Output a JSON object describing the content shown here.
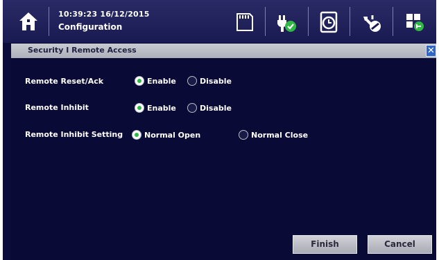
{
  "header": {
    "time": "10:39:23 16/12/2015",
    "context": "Configuration"
  },
  "icons": {
    "home": "home-icon",
    "sd_card": "sd-card-icon",
    "plug": "plug-check-icon",
    "clock": "clock-icon",
    "tools": "tools-icon",
    "grid": "grid-icon"
  },
  "dialog": {
    "title": "Security I Remote Access",
    "close_label": "✕",
    "rows": [
      {
        "label": "Remote Reset/Ack",
        "options": [
          {
            "label": "Enable",
            "selected": true
          },
          {
            "label": "Disable",
            "selected": false
          }
        ]
      },
      {
        "label": "Remote Inhibit",
        "options": [
          {
            "label": "Enable",
            "selected": true
          },
          {
            "label": "Disable",
            "selected": false
          }
        ]
      },
      {
        "label": "Remote Inhibit Setting",
        "options": [
          {
            "label": "Normal Open",
            "selected": true
          },
          {
            "label": "Normal Close",
            "selected": false
          }
        ]
      }
    ],
    "buttons": {
      "finish": "Finish",
      "cancel": "Cancel"
    }
  },
  "colors": {
    "background": "#0c0c3a",
    "accent_green": "#2fb844",
    "close_blue": "#2f67c9"
  }
}
